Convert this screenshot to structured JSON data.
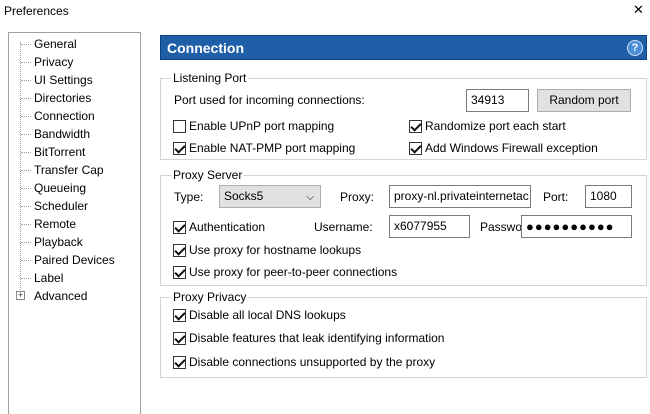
{
  "window": {
    "title": "Preferences"
  },
  "sidebar": {
    "items": [
      {
        "label": "General"
      },
      {
        "label": "Privacy"
      },
      {
        "label": "UI Settings"
      },
      {
        "label": "Directories"
      },
      {
        "label": "Connection"
      },
      {
        "label": "Bandwidth"
      },
      {
        "label": "BitTorrent"
      },
      {
        "label": "Transfer Cap"
      },
      {
        "label": "Queueing"
      },
      {
        "label": "Scheduler"
      },
      {
        "label": "Remote"
      },
      {
        "label": "Playback"
      },
      {
        "label": "Paired Devices"
      },
      {
        "label": "Label"
      },
      {
        "label": "Advanced"
      }
    ],
    "expander": "+"
  },
  "header": {
    "title": "Connection",
    "help": "?"
  },
  "listening": {
    "title": "Listening Port",
    "port_label": "Port used for incoming connections:",
    "port_value": "34913",
    "random_btn": "Random port",
    "upnp": {
      "label": "Enable UPnP port mapping",
      "checked": false
    },
    "natpmp": {
      "label": "Enable NAT-PMP port mapping",
      "checked": true
    },
    "randomize": {
      "label": "Randomize port each start",
      "checked": true
    },
    "firewall": {
      "label": "Add Windows Firewall exception",
      "checked": true
    }
  },
  "proxy": {
    "title": "Proxy Server",
    "type_label": "Type:",
    "type_value": "Socks5",
    "proxy_label": "Proxy:",
    "proxy_value": "proxy-nl.privateinternetac",
    "port_label": "Port:",
    "port_value": "1080",
    "auth": {
      "label": "Authentication",
      "checked": true
    },
    "username_label": "Username:",
    "username_value": "x6077955",
    "password_label": "Password:",
    "password_value": "●●●●●●●●●●",
    "hostname": {
      "label": "Use proxy for hostname lookups",
      "checked": true
    },
    "p2p": {
      "label": "Use proxy for peer-to-peer connections",
      "checked": true
    }
  },
  "privacy": {
    "title": "Proxy Privacy",
    "dns": {
      "label": "Disable all local DNS lookups",
      "checked": true
    },
    "leak": {
      "label": "Disable features that leak identifying information",
      "checked": true
    },
    "unsupported": {
      "label": "Disable connections unsupported by the proxy",
      "checked": true
    }
  },
  "icons": {
    "close": "close-icon",
    "help": "help-icon",
    "dropdown": "chevron-down-icon"
  },
  "colors": {
    "header_bg": "#1f5fa8"
  }
}
